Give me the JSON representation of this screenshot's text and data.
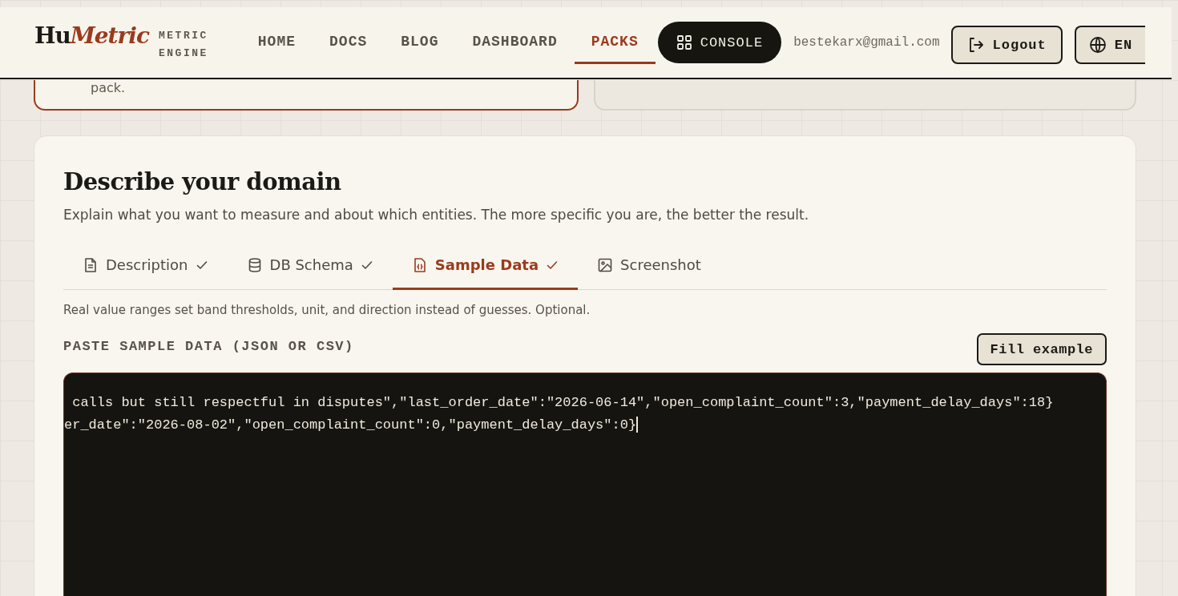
{
  "header": {
    "logo": [
      {
        "text": "Hu",
        "kind": "plain"
      },
      {
        "text": "Metric",
        "kind": "accent"
      }
    ],
    "tagline": [
      "METRIC",
      "ENGINE"
    ],
    "nav": [
      {
        "label": "HOME",
        "selected": false
      },
      {
        "label": "DOCS",
        "selected": false
      },
      {
        "label": "BLOG",
        "selected": false
      },
      {
        "label": "DASHBOARD",
        "selected": false
      },
      {
        "label": "PACKS",
        "selected": true
      }
    ],
    "console_button": "CONSOLE",
    "email": "bestekarx@gmail.com",
    "logout_button": "Logout",
    "language_button": "EN"
  },
  "top_cards": [
    {
      "text": "pack.",
      "selected": true
    },
    {
      "selected": false
    }
  ],
  "domain": {
    "title": "Describe your domain",
    "subtitle": "Explain what you want to measure and about which entities. The more specific you are, the better the result.",
    "tabs": [
      {
        "label": "Description",
        "kind": "document",
        "done": true,
        "selected": false
      },
      {
        "label": "DB Schema",
        "kind": "database",
        "done": true,
        "selected": false
      },
      {
        "label": "Sample Data",
        "kind": "data",
        "done": true,
        "selected": true
      },
      {
        "label": "Screenshot",
        "kind": "image",
        "done": false,
        "selected": false
      }
    ],
    "help": "Real value ranges set band thresholds, unit, and direction instead of guesses. Optional.",
    "field_label": "PASTE SAMPLE DATA (JSON OR CSV)",
    "fill_button": "Fill example",
    "value_lines": [
      " calls but still respectful in disputes\",\"last_order_date\":\"2026-06-14\",\"open_complaint_count\":3,\"payment_delay_days\":18}",
      "er_date\":\"2026-08-02\",\"open_complaint_count\":0,\"payment_delay_days\":0}"
    ]
  }
}
